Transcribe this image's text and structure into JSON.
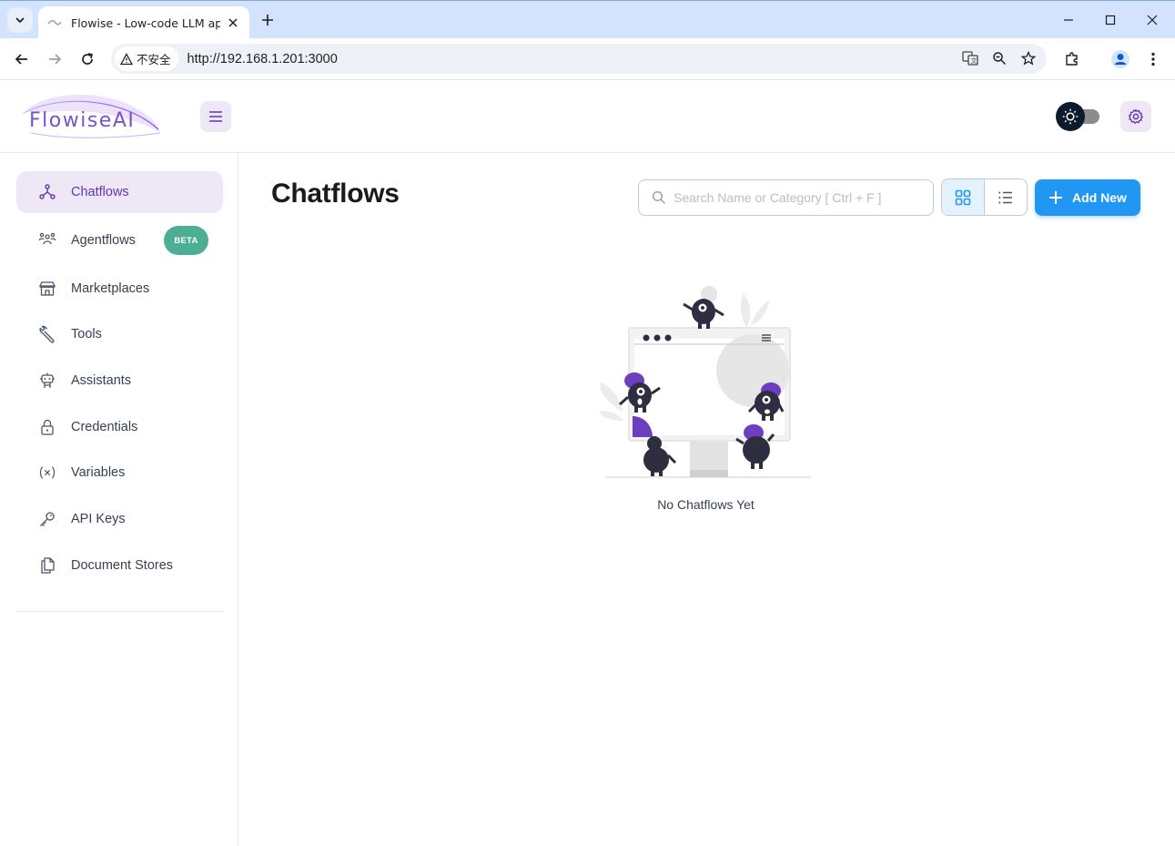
{
  "browser": {
    "tab_title": "Flowise - Low-code LLM apps",
    "security_label": "不安全",
    "url": "http://192.168.1.201:3000"
  },
  "app": {
    "logo_text": "FlowiseAI",
    "brand_color": "#5e35b1"
  },
  "sidebar": {
    "items": [
      {
        "label": "Chatflows",
        "icon": "chatflows-icon",
        "active": true
      },
      {
        "label": "Agentflows",
        "icon": "agentflows-icon",
        "badge": "BETA"
      },
      {
        "label": "Marketplaces",
        "icon": "store-icon"
      },
      {
        "label": "Tools",
        "icon": "wrench-icon"
      },
      {
        "label": "Assistants",
        "icon": "robot-icon"
      },
      {
        "label": "Credentials",
        "icon": "lock-icon"
      },
      {
        "label": "Variables",
        "icon": "variable-icon"
      },
      {
        "label": "API Keys",
        "icon": "key-icon"
      },
      {
        "label": "Document Stores",
        "icon": "files-icon"
      }
    ]
  },
  "main": {
    "title": "Chatflows",
    "search_placeholder": "Search Name or Category [ Ctrl + F ]",
    "add_button": "Add New",
    "empty_message": "No Chatflows Yet"
  },
  "colors": {
    "accent": "#2196f3",
    "active_bg": "#ede7f6",
    "badge": "#4caf94"
  }
}
